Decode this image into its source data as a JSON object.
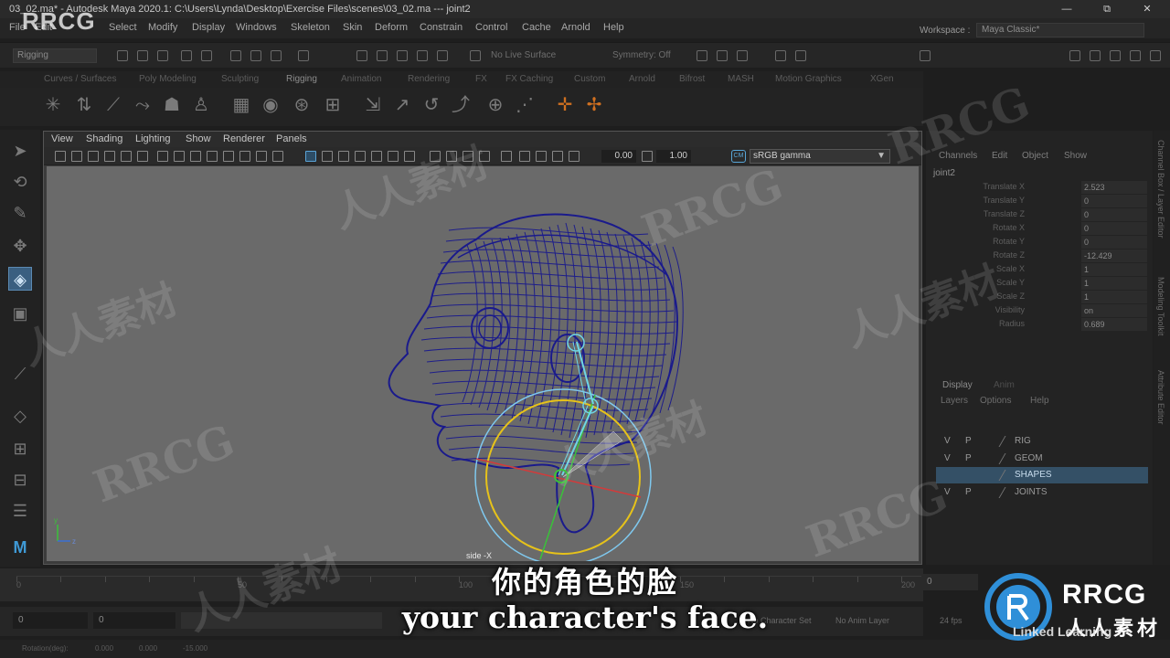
{
  "window": {
    "title": "03_02.ma* - Autodesk Maya 2020.1: C:\\Users\\Lynda\\Desktop\\Exercise Files\\scenes\\03_02.ma   ---   joint2",
    "minimize": "—",
    "restore": "⧉",
    "close": "✕"
  },
  "menubar": {
    "items": [
      "File",
      "Edit",
      "Select",
      "Modify",
      "Display",
      "Windows",
      "Skeleton",
      "Skin",
      "Deform",
      "Constrain",
      "Control",
      "Cache",
      "Arnold",
      "Help"
    ],
    "workspace_label": "Workspace :",
    "workspace_value": "Maya Classic*"
  },
  "statusline": {
    "menuset": "Rigging",
    "live_surface": "No Live Surface",
    "symmetry": "Symmetry: Off"
  },
  "shelf": {
    "tabs": [
      "Curves / Surfaces",
      "Poly Modeling",
      "Sculpting",
      "Rigging",
      "Animation",
      "Rendering",
      "FX",
      "FX Caching",
      "Custom",
      "Arnold",
      "Bifrost",
      "MASH",
      "Motion Graphics",
      "XGen"
    ],
    "active_tab": "Rigging"
  },
  "viewport": {
    "panel_menu": [
      "View",
      "Shading",
      "Lighting",
      "Show",
      "Renderer",
      "Panels"
    ],
    "exposure": "0.00",
    "gamma": "1.00",
    "color_space": "sRGB gamma",
    "camera_label": "side -X",
    "colors": {
      "wireframe": "#1a1a8c",
      "joint": "#6fd6e6",
      "ring_outer": "#7fc8ee",
      "ring_inner": "#e6c21a",
      "axis_x": "#d43a3a",
      "axis_y": "#3ac23a"
    }
  },
  "channelbox": {
    "menus": [
      "Channels",
      "Edit",
      "Object",
      "Show"
    ],
    "node": "joint2",
    "attributes": [
      {
        "name": "Translate X",
        "value": "2.523"
      },
      {
        "name": "Translate Y",
        "value": "0"
      },
      {
        "name": "Translate Z",
        "value": "0"
      },
      {
        "name": "Rotate X",
        "value": "0"
      },
      {
        "name": "Rotate Y",
        "value": "0"
      },
      {
        "name": "Rotate Z",
        "value": "-12.429"
      },
      {
        "name": "Scale X",
        "value": "1"
      },
      {
        "name": "Scale Y",
        "value": "1"
      },
      {
        "name": "Scale Z",
        "value": "1"
      },
      {
        "name": "Visibility",
        "value": "on"
      },
      {
        "name": "Radius",
        "value": "0.689"
      }
    ],
    "side_tabs": [
      "Channel Box / Layer Editor",
      "Modeling Toolkit",
      "Attribute Editor"
    ]
  },
  "layer_editor": {
    "tabs": [
      "Display",
      "Anim"
    ],
    "menus": [
      "Layers",
      "Options",
      "Help"
    ],
    "layers": [
      {
        "v": "V",
        "p": "P",
        "name": "RIG",
        "selected": false
      },
      {
        "v": "V",
        "p": "P",
        "name": "GEOM",
        "selected": false
      },
      {
        "v": "",
        "p": "",
        "name": "SHAPES",
        "selected": true
      },
      {
        "v": "V",
        "p": "P",
        "name": "JOINTS",
        "selected": false
      }
    ]
  },
  "timeslider": {
    "ticks": [
      "0",
      "",
      "",
      "",
      "",
      "50",
      "",
      "",
      "",
      "",
      "100",
      "",
      "",
      "",
      "",
      "150",
      "",
      "",
      "",
      "",
      "200"
    ],
    "current_frame": "0"
  },
  "rangeslider": {
    "start": "0",
    "inner_start": "0",
    "character_set": "No Character Set",
    "anim_layer": "No Anim Layer",
    "fps": "24 fps"
  },
  "cmdline": {
    "text": "Rotation(deg):",
    "values": [
      "0.000",
      "0.000",
      "-15.000"
    ]
  },
  "subtitles": {
    "chinese": "你的角色的脸",
    "english": "your character's face."
  },
  "watermarks": {
    "corner": "RRCG",
    "latin": "RRCG",
    "chinese": "人人素材",
    "brand_latin": "RRCG",
    "brand_chinese": "人人素材",
    "linkedin": "Linked Learning"
  }
}
